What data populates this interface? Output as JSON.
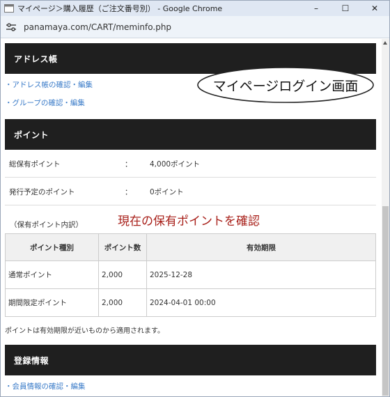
{
  "browser": {
    "title": "マイページ＞購入履歴（ご注文番号別） - Google Chrome",
    "url": "panamaya.com/CART/meminfo.php",
    "controls": {
      "minimize": "–",
      "maximize": "☐",
      "close": "✕"
    }
  },
  "address_section": {
    "header": "アドレス帳",
    "links": [
      "・アドレス帳の確認・編集",
      "・グループの確認・編集"
    ]
  },
  "points_section": {
    "header": "ポイント",
    "rows": [
      {
        "label": "総保有ポイント",
        "colon": "：",
        "value": "4,000ポイント"
      },
      {
        "label": "発行予定のポイント",
        "colon": "：",
        "value": "0ポイント"
      }
    ],
    "breakdown_label": "（保有ポイント内訳）",
    "table": {
      "headers": [
        "ポイント種別",
        "ポイント数",
        "有効期限"
      ],
      "rows": [
        [
          "通常ポイント",
          "2,000",
          "2025-12-28"
        ],
        [
          "期間限定ポイント",
          "2,000",
          "2024-04-01 00:00"
        ]
      ]
    },
    "note": "ポイントは有効期限が近いものから適用されます。"
  },
  "registration_section": {
    "header": "登録情報",
    "links": [
      "・会員情報の確認・編集"
    ]
  },
  "annotations": {
    "callout": "マイページログイン画面",
    "red_note": "現在の保有ポイントを確認",
    "red_color": "#a8201a"
  }
}
